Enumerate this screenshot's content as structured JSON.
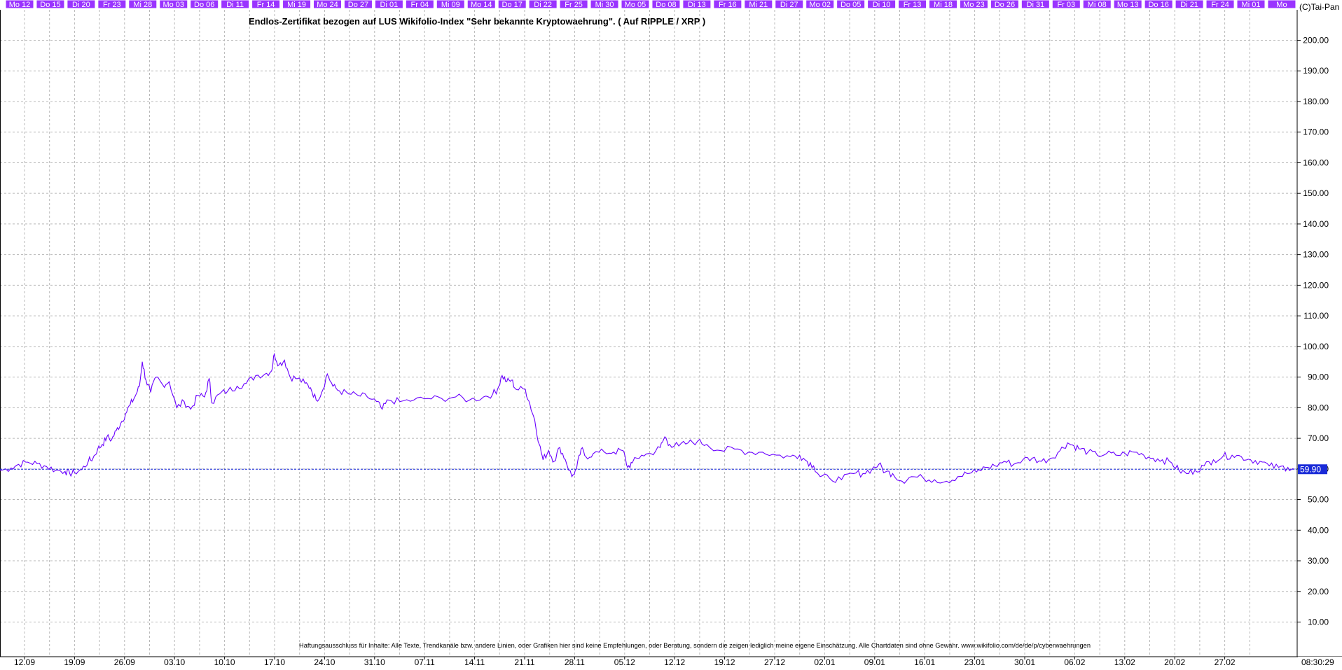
{
  "chart_data": {
    "type": "line",
    "title": "Endlos-Zertifikat bezogen auf LUS Wikifolio-Index \"Sehr bekannte Kryptowaehrung\". ( Auf RIPPLE / XRP )",
    "copyright": "(C)Tai-Pan",
    "disclaimer": "Haftungsausschluss für Inhalte: Alle Texte, Trendkanäle bzw. andere Linien, oder Grafiken hier sind keine Empfehlungen, oder Beratung, sondern die zeigen lediglich meine eigene Einschätzung. Alle Chartdaten sind ohne Gewähr.  www.wikifolio.com/de/de/p/cyberwaehrungen",
    "time_label": "08:30:29",
    "last_value_label": "59.90",
    "last_value": 59.9,
    "ylim": [
      0,
      210
    ],
    "y_ticks": [
      "10.00",
      "20.00",
      "30.00",
      "40.00",
      "50.00",
      "60.00",
      "70.00",
      "80.00",
      "90.00",
      "100.00",
      "110.00",
      "120.00",
      "130.00",
      "140.00",
      "150.00",
      "160.00",
      "170.00",
      "180.00",
      "190.00",
      "200.00"
    ],
    "top_day_labels": [
      "Mo 12",
      "Do 15",
      "Di 20",
      "Fr 23",
      "Mi 28",
      "Mo 03",
      "Do 06",
      "Di 11",
      "Fr 14",
      "Mi 19",
      "Mo 24",
      "Do 27",
      "Di 01",
      "Fr 04",
      "Mi 09",
      "Mo 14",
      "Do 17",
      "Di 22",
      "Fr 25",
      "Mi 30",
      "Mo 05",
      "Do 08",
      "Di 13",
      "Fr 16",
      "Mi 21",
      "Di 27",
      "Mo 02",
      "Do 05",
      "Di 10",
      "Fr 13",
      "Mi 18",
      "Mo 23",
      "Do 26",
      "Di 31",
      "Fr 03",
      "Mi 08",
      "Mo 13",
      "Do 16",
      "Di 21",
      "Fr 24",
      "Mi 01",
      "Mo"
    ],
    "bottom_date_labels": [
      "12.09",
      "19.09",
      "26.09",
      "03.10",
      "10.10",
      "17.10",
      "24.10",
      "31.10",
      "07.11",
      "14.11",
      "21.11",
      "28.11",
      "05.12",
      "12.12",
      "19.12",
      "27.12",
      "02.01",
      "09.01",
      "16.01",
      "23.01",
      "30.01",
      "06.02",
      "13.02",
      "20.02",
      "27.02"
    ],
    "x_dates": [
      "2017-09-12",
      "2017-09-19",
      "2017-09-26",
      "2017-10-03",
      "2017-10-10",
      "2017-10-17",
      "2017-10-24",
      "2017-10-31",
      "2017-11-07",
      "2017-11-14",
      "2017-11-21",
      "2017-11-28",
      "2017-12-05",
      "2017-12-12",
      "2017-12-19",
      "2017-12-27",
      "2018-01-02",
      "2018-01-09",
      "2018-01-16",
      "2018-01-23",
      "2018-01-30",
      "2018-02-06",
      "2018-02-13",
      "2018-02-20",
      "2018-02-27"
    ],
    "grid": true,
    "colors": {
      "line": "#6a00ff",
      "axis_text": "#000000",
      "grid": "#b8b8b8",
      "day_box": "#9a33ff",
      "last_box": "#1a2bd8"
    },
    "series": [
      {
        "values": [
          [
            0.0,
            59.5
          ],
          [
            0.012,
            60.3
          ],
          [
            0.02,
            61.5
          ],
          [
            0.03,
            62.2
          ],
          [
            0.04,
            61.7
          ],
          [
            0.05,
            60.8
          ],
          [
            0.06,
            59.6
          ],
          [
            0.07,
            59.2
          ],
          [
            0.075,
            58.5
          ],
          [
            0.08,
            58.9
          ],
          [
            0.088,
            59.8
          ],
          [
            0.095,
            62.5
          ],
          [
            0.1,
            63.5
          ],
          [
            0.105,
            66.5
          ],
          [
            0.11,
            68.0
          ],
          [
            0.115,
            70.5
          ],
          [
            0.12,
            69.5
          ],
          [
            0.125,
            72.5
          ],
          [
            0.13,
            75.0
          ],
          [
            0.135,
            78.0
          ],
          [
            0.14,
            81.0
          ],
          [
            0.145,
            83.5
          ],
          [
            0.15,
            87.0
          ],
          [
            0.153,
            95.0
          ],
          [
            0.157,
            89.0
          ],
          [
            0.162,
            85.0
          ],
          [
            0.168,
            90.0
          ],
          [
            0.175,
            87.5
          ],
          [
            0.182,
            88.5
          ],
          [
            0.19,
            80.0
          ],
          [
            0.198,
            82.0
          ],
          [
            0.205,
            79.5
          ],
          [
            0.213,
            84.0
          ],
          [
            0.22,
            83.5
          ],
          [
            0.225,
            89.5
          ],
          [
            0.228,
            81.5
          ],
          [
            0.236,
            84.5
          ],
          [
            0.245,
            85.5
          ],
          [
            0.255,
            87.0
          ],
          [
            0.265,
            88.0
          ],
          [
            0.275,
            90.5
          ],
          [
            0.285,
            91.0
          ],
          [
            0.292,
            92.0
          ],
          [
            0.295,
            97.5
          ],
          [
            0.3,
            94.0
          ],
          [
            0.306,
            95.5
          ],
          [
            0.312,
            90.0
          ],
          [
            0.32,
            89.5
          ],
          [
            0.328,
            88.0
          ],
          [
            0.334,
            86.5
          ],
          [
            0.34,
            82.5
          ],
          [
            0.346,
            85.0
          ],
          [
            0.352,
            91.0
          ],
          [
            0.358,
            87.0
          ],
          [
            0.365,
            85.5
          ],
          [
            0.375,
            84.5
          ],
          [
            0.385,
            84.0
          ],
          [
            0.395,
            83.5
          ],
          [
            0.405,
            82.0
          ],
          [
            0.411,
            79.5
          ],
          [
            0.418,
            82.5
          ],
          [
            0.43,
            82.0
          ],
          [
            0.445,
            82.5
          ],
          [
            0.46,
            83.0
          ],
          [
            0.475,
            83.0
          ],
          [
            0.49,
            83.5
          ],
          [
            0.505,
            82.5
          ],
          [
            0.52,
            83.5
          ],
          [
            0.53,
            84.5
          ],
          [
            0.535,
            86.0
          ],
          [
            0.54,
            90.5
          ],
          [
            0.545,
            88.5
          ],
          [
            0.55,
            89.0
          ],
          [
            0.555,
            86.0
          ],
          [
            0.565,
            86.0
          ],
          [
            0.57,
            81.0
          ],
          [
            0.575,
            76.0
          ],
          [
            0.58,
            68.0
          ],
          [
            0.584,
            63.0
          ],
          [
            0.59,
            66.0
          ],
          [
            0.596,
            62.5
          ],
          [
            0.602,
            67.0
          ],
          [
            0.608,
            63.0
          ],
          [
            0.615,
            57.5
          ],
          [
            0.62,
            60.0
          ],
          [
            0.625,
            66.5
          ],
          [
            0.63,
            64.0
          ],
          [
            0.638,
            65.0
          ],
          [
            0.65,
            65.5
          ],
          [
            0.66,
            65.5
          ],
          [
            0.67,
            66.0
          ],
          [
            0.675,
            60.5
          ],
          [
            0.68,
            62.0
          ],
          [
            0.69,
            64.5
          ],
          [
            0.7,
            65.0
          ],
          [
            0.71,
            67.0
          ],
          [
            0.715,
            70.5
          ],
          [
            0.72,
            68.0
          ],
          [
            0.73,
            67.5
          ],
          [
            0.74,
            68.5
          ],
          [
            0.75,
            69.0
          ],
          [
            0.76,
            68.0
          ],
          [
            0.775,
            66.0
          ],
          [
            0.79,
            66.5
          ],
          [
            0.805,
            65.5
          ],
          [
            0.82,
            65.5
          ],
          [
            0.835,
            64.5
          ],
          [
            0.85,
            64.0
          ],
          [
            0.86,
            64.5
          ],
          [
            0.868,
            62.5
          ],
          [
            0.875,
            61.0
          ],
          [
            0.882,
            57.5
          ],
          [
            0.892,
            57.0
          ],
          [
            0.905,
            56.5
          ],
          [
            0.918,
            58.5
          ],
          [
            0.928,
            58.5
          ],
          [
            0.938,
            60.0
          ],
          [
            0.945,
            61.5
          ],
          [
            0.952,
            59.0
          ],
          [
            0.96,
            58.5
          ],
          [
            0.97,
            56.0
          ],
          [
            0.98,
            57.5
          ],
          [
            0.993,
            57.0
          ],
          [
            1.005,
            56.5
          ],
          [
            1.018,
            56.0
          ],
          [
            1.03,
            57.5
          ],
          [
            1.04,
            58.5
          ],
          [
            1.05,
            59.0
          ],
          [
            1.06,
            60.5
          ],
          [
            1.07,
            61.0
          ],
          [
            1.08,
            62.5
          ],
          [
            1.09,
            61.5
          ],
          [
            1.1,
            63.0
          ],
          [
            1.11,
            63.5
          ],
          [
            1.12,
            62.5
          ],
          [
            1.13,
            63.5
          ],
          [
            1.14,
            66.0
          ],
          [
            1.148,
            68.5
          ],
          [
            1.155,
            67.5
          ],
          [
            1.162,
            66.5
          ],
          [
            1.17,
            65.5
          ],
          [
            1.18,
            64.5
          ],
          [
            1.19,
            65.0
          ],
          [
            1.2,
            64.5
          ],
          [
            1.21,
            65.0
          ],
          [
            1.22,
            65.5
          ],
          [
            1.23,
            64.5
          ],
          [
            1.24,
            63.5
          ],
          [
            1.25,
            63.0
          ],
          [
            1.26,
            62.0
          ],
          [
            1.268,
            59.5
          ],
          [
            1.276,
            58.5
          ],
          [
            1.285,
            59.5
          ],
          [
            1.295,
            61.0
          ],
          [
            1.305,
            63.0
          ],
          [
            1.315,
            64.0
          ],
          [
            1.325,
            64.5
          ],
          [
            1.335,
            64.0
          ],
          [
            1.345,
            63.0
          ],
          [
            1.355,
            62.5
          ],
          [
            1.365,
            61.0
          ],
          [
            1.375,
            60.5
          ],
          [
            1.385,
            60.5
          ],
          [
            1.392,
            59.9
          ]
        ]
      }
    ]
  }
}
